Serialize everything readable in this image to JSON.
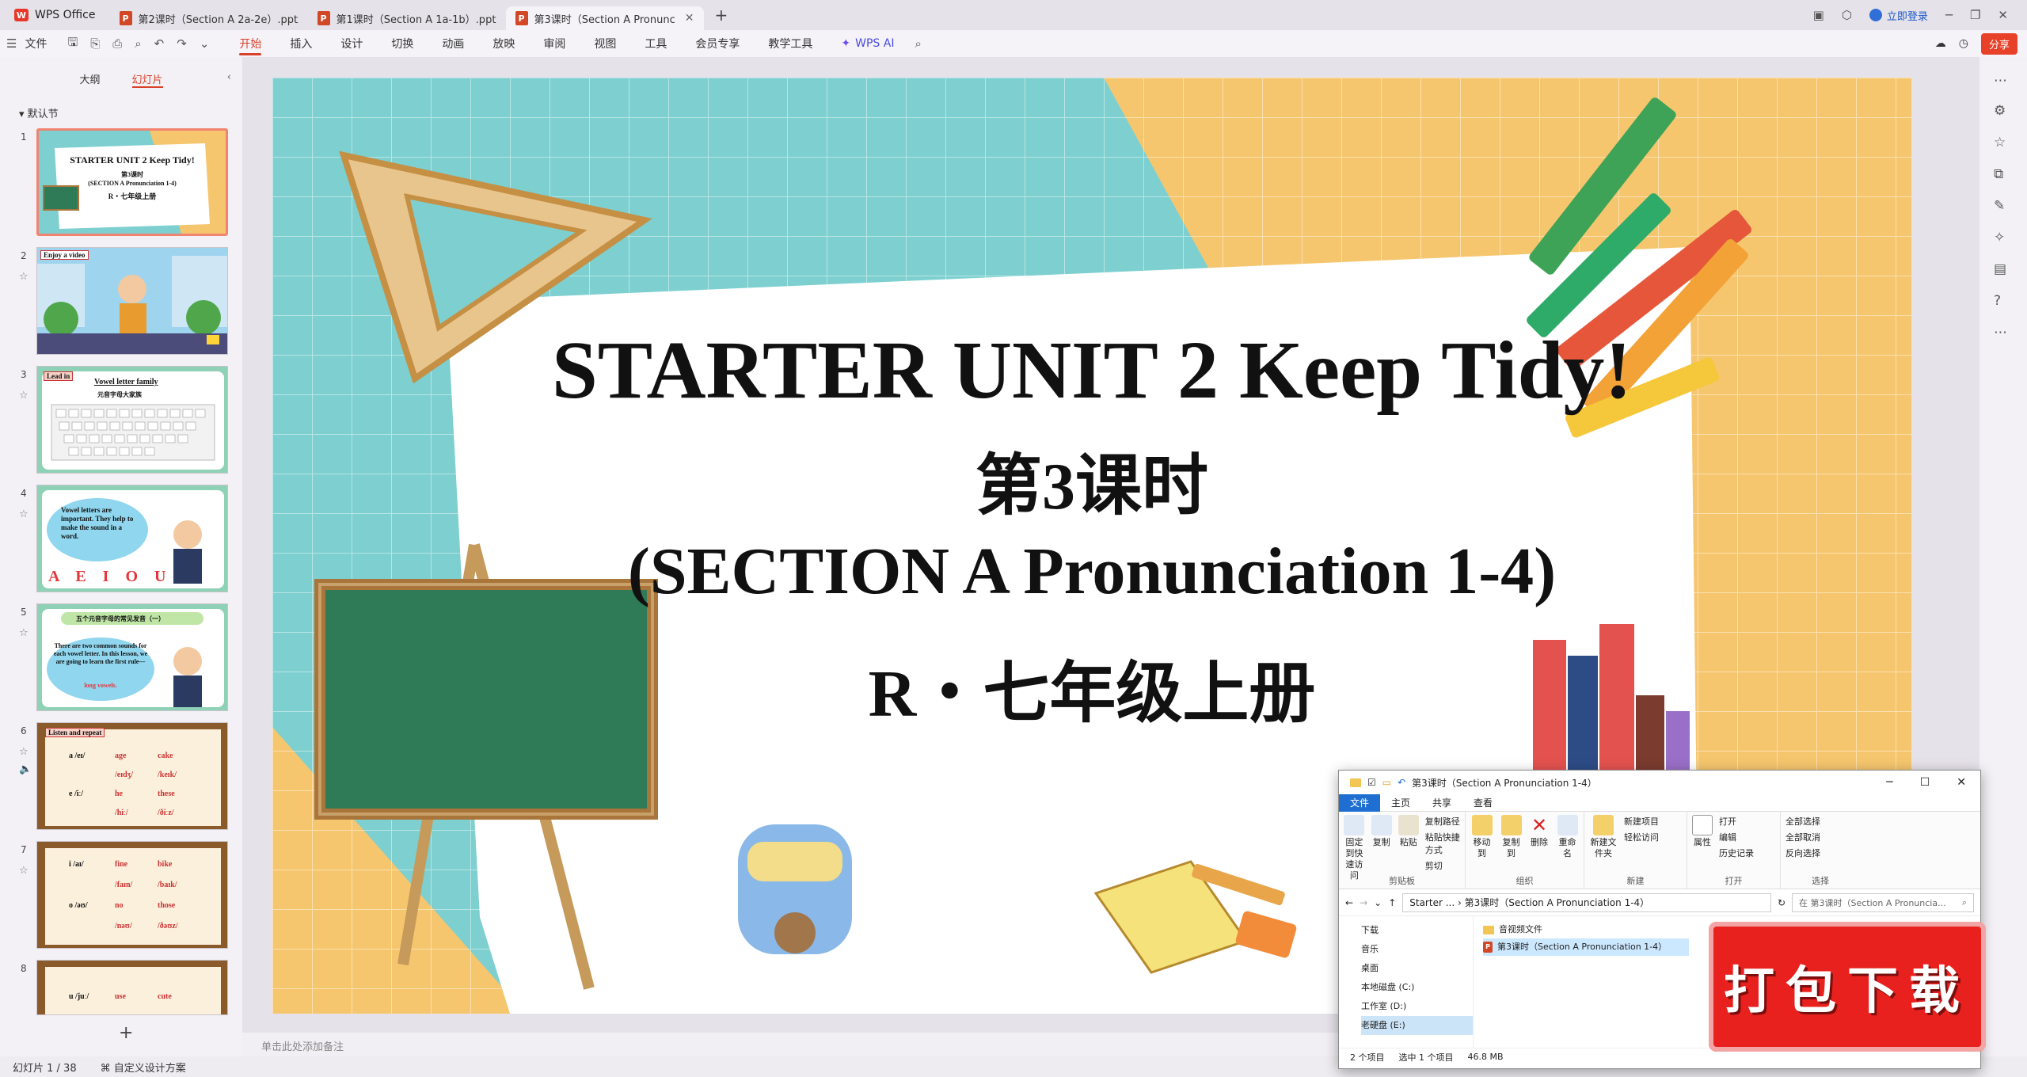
{
  "titlebar": {
    "app_name": "WPS Office",
    "tabs": [
      {
        "label": "第2课时（Section A 2a-2e）.pptx"
      },
      {
        "label": "第1课时（Section A 1a-1b）.pptx"
      },
      {
        "label": "第3课时（Section A Pronunc"
      }
    ],
    "add_tab": "+",
    "login": "立即登录"
  },
  "menubar": {
    "file": "文件",
    "items": [
      "开始",
      "插入",
      "设计",
      "切换",
      "动画",
      "放映",
      "审阅",
      "视图",
      "工具",
      "会员专享",
      "教学工具"
    ],
    "ai": "WPS AI",
    "share": "分享"
  },
  "leftpanel": {
    "tab_outline": "大纲",
    "tab_slides": "幻灯片",
    "section": "默认节",
    "add": "+",
    "slides": [
      {
        "num": "1",
        "title": "STARTER UNIT 2 Keep Tidy!",
        "sub1": "第3课时",
        "sub2": "(SECTION A Pronunciation 1-4)",
        "sub3": "R・七年级上册"
      },
      {
        "num": "2",
        "tag": "Enjoy a video"
      },
      {
        "num": "3",
        "tag": "Lead in",
        "title": "Vowel letter family",
        "sub": "元音字母大家族"
      },
      {
        "num": "4",
        "text": "Vowel letters are important. They help to make the sound in a word.",
        "letters": "A E I O U"
      },
      {
        "num": "5",
        "title": "五个元音字母的常见发音（一）",
        "text": "There are two common sounds for each vowel letter. In this lesson, we are going to learn the first rule—",
        "hl": "long vowels."
      },
      {
        "num": "6",
        "tag": "Listen and repeat",
        "rows": [
          [
            "a /eɪ/",
            "age",
            "cake"
          ],
          [
            "",
            "/eɪdʒ/",
            "/keɪk/"
          ],
          [
            "e /iː/",
            "he",
            "these"
          ],
          [
            "",
            "/hiː/",
            "/ðiːz/"
          ]
        ]
      },
      {
        "num": "7",
        "rows": [
          [
            "i /aɪ/",
            "fine",
            "bike"
          ],
          [
            "",
            "/faɪn/",
            "/baɪk/"
          ],
          [
            "o /əʊ/",
            "no",
            "those"
          ],
          [
            "",
            "/nəʊ/",
            "/ðəʊz/"
          ]
        ]
      },
      {
        "num": "8",
        "rows": [
          [
            "u /juː/",
            "use",
            "cute"
          ]
        ]
      }
    ]
  },
  "slide": {
    "title": "STARTER UNIT 2 Keep Tidy!",
    "line2": "第3课时",
    "line3": "(SECTION A Pronunciation 1-4)",
    "line4": "R・七年级上册"
  },
  "notes_placeholder": "单击此处添加备注",
  "statusbar": {
    "slide_count": "幻灯片 1 / 38",
    "design": "自定义设计方案"
  },
  "explorer": {
    "title": "第3课时（Section A Pronunciation 1-4）",
    "ribbon_tabs": [
      "文件",
      "主页",
      "共享",
      "查看"
    ],
    "groups": {
      "clipboard": {
        "label": "剪贴板",
        "pin": "固定到快速访问",
        "copy": "复制",
        "paste": "粘贴",
        "copy_path": "复制路径",
        "paste_shortcut": "粘贴快捷方式",
        "cut": "剪切"
      },
      "organize": {
        "label": "组织",
        "move": "移动到",
        "copy_to": "复制到",
        "delete": "删除",
        "rename": "重命名"
      },
      "new": {
        "label": "新建",
        "new_folder": "新建文件夹",
        "new_item": "新建项目",
        "easy_access": "轻松访问"
      },
      "open": {
        "label": "打开",
        "properties": "属性",
        "open": "打开",
        "edit": "编辑",
        "history": "历史记录"
      },
      "select": {
        "label": "选择",
        "all": "全部选择",
        "none": "全部取消",
        "invert": "反向选择"
      }
    },
    "address": "Starter ... › 第3课时（Section A Pronunciation 1-4）",
    "search_placeholder": "在 第3课时（Section A Pronuncia...",
    "nav": [
      "下载",
      "音乐",
      "桌面",
      "本地磁盘 (C:)",
      "工作室 (D:)",
      "老硬盘 (E:)"
    ],
    "files": [
      "音视频文件",
      "第3课时（Section A Pronunciation 1-4）"
    ],
    "status": {
      "count": "2 个项目",
      "selected": "选中 1 个项目",
      "size": "46.8 MB"
    }
  },
  "download_badge": "打包下载"
}
